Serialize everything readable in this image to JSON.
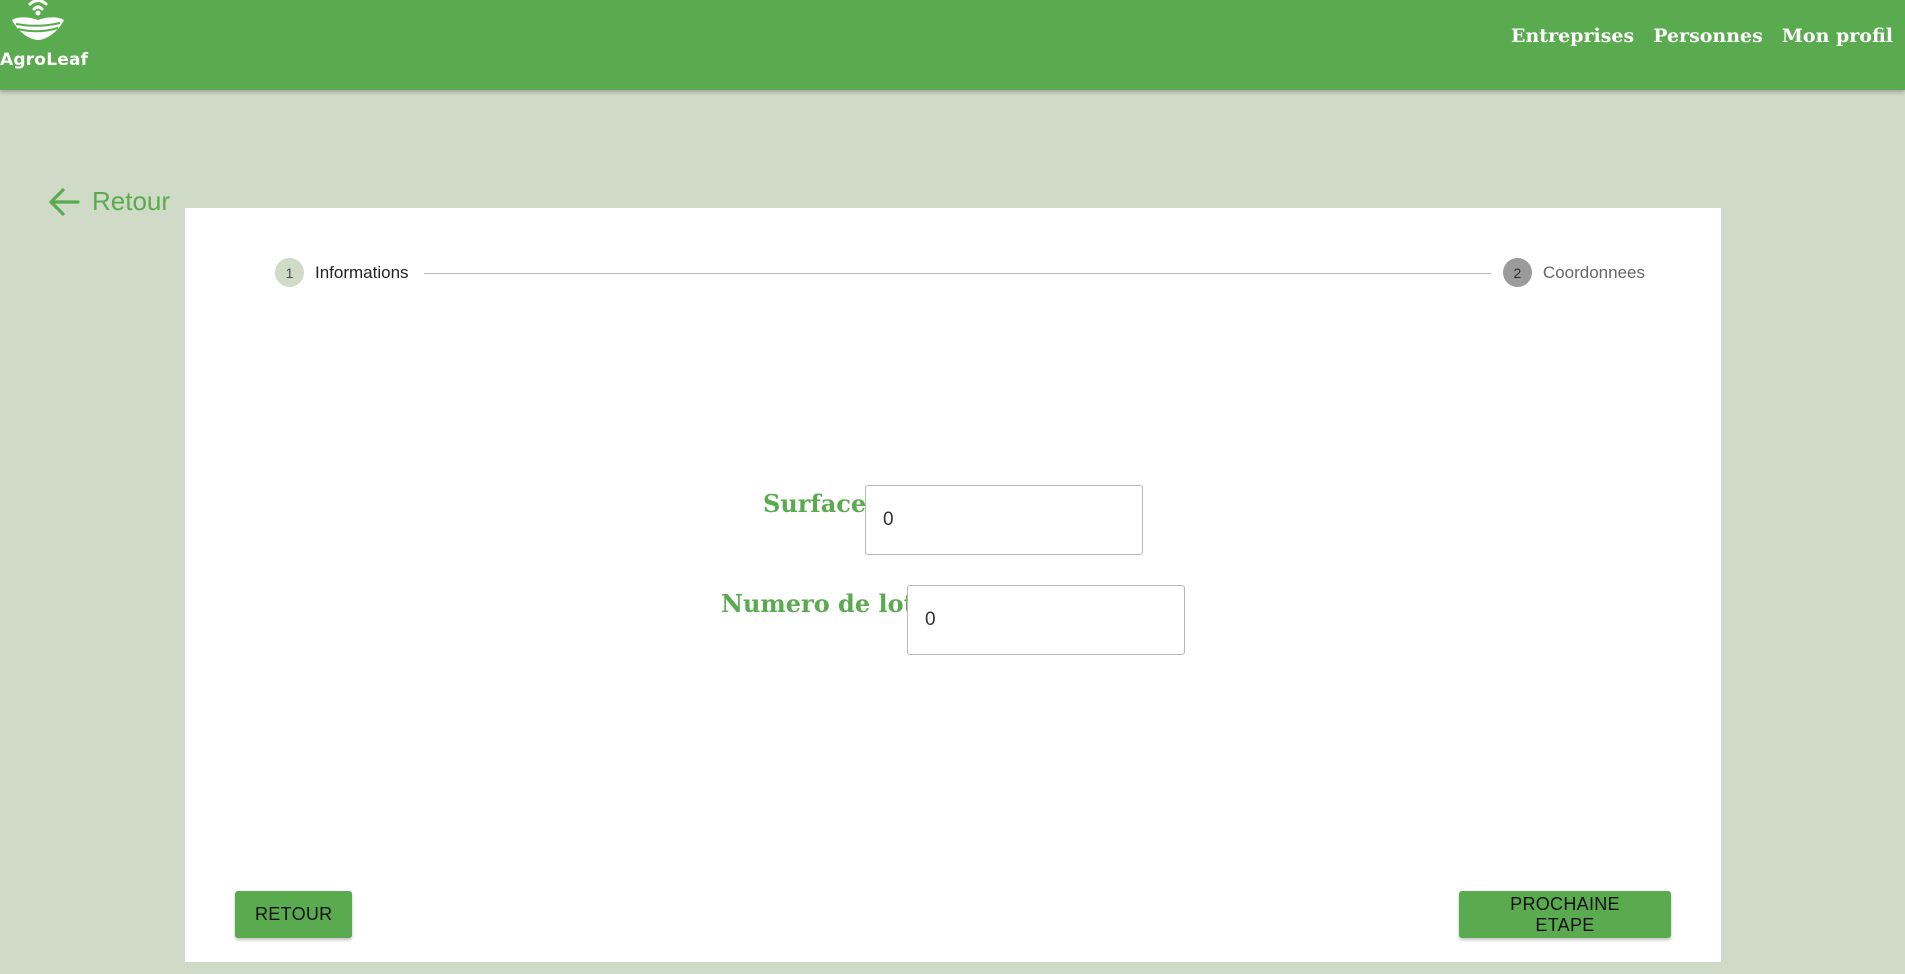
{
  "brand": {
    "name": "AgroLeaf",
    "colors": {
      "primary": "#5aaa4f",
      "background": "#d0dbc7",
      "card": "#ffffff"
    }
  },
  "nav": {
    "items": [
      {
        "label": "Entreprises"
      },
      {
        "label": "Personnes"
      },
      {
        "label": "Mon profil"
      }
    ]
  },
  "back_link": {
    "icon": "arrow-left-icon",
    "label": "Retour"
  },
  "stepper": {
    "steps": [
      {
        "number": "1",
        "label": "Informations",
        "state": "active"
      },
      {
        "number": "2",
        "label": "Coordonnees",
        "state": "inactive"
      }
    ]
  },
  "form": {
    "surface": {
      "label": "Surface:",
      "value": "0"
    },
    "numero_lot": {
      "label": "Numero de lot:",
      "value": "0"
    }
  },
  "buttons": {
    "back": "RETOUR",
    "next": "PROCHAINE ETAPE"
  }
}
